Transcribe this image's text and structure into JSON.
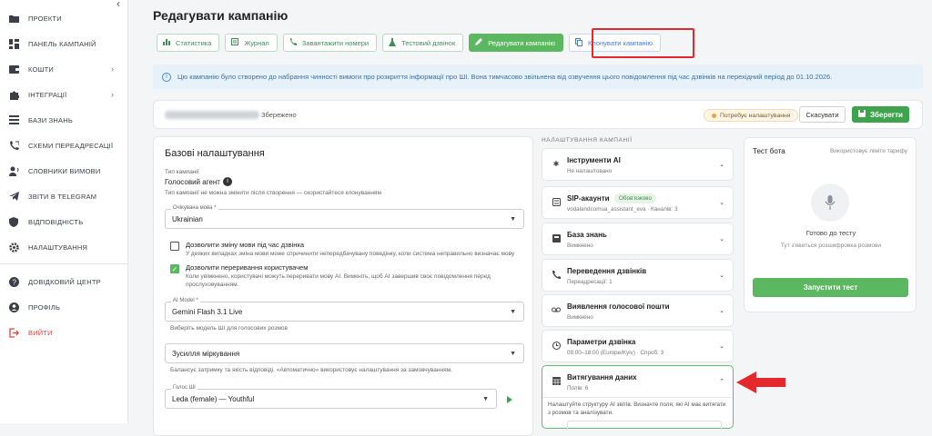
{
  "sidebar": {
    "items": [
      {
        "label": "Проекти",
        "icon": "folder-icon",
        "arrow": ""
      },
      {
        "label": "Панель кампаній",
        "icon": "dashboard-icon",
        "arrow": ""
      },
      {
        "label": "Кошти",
        "icon": "wallet-icon",
        "arrow": "›"
      },
      {
        "label": "Інтеграції",
        "icon": "puzzle-icon",
        "arrow": "›"
      },
      {
        "label": "Бази знань",
        "icon": "list-icon",
        "arrow": ""
      },
      {
        "label": "Схеми переадресації",
        "icon": "phone-forward-icon",
        "arrow": ""
      },
      {
        "label": "Словники вимови",
        "icon": "speaker-icon",
        "arrow": ""
      },
      {
        "label": "Звіти в Telegram",
        "icon": "telegram-icon",
        "arrow": ""
      },
      {
        "label": "Відповідність",
        "icon": "shield-icon",
        "arrow": ""
      },
      {
        "label": "Налаштування",
        "icon": "gear-icon",
        "arrow": ""
      },
      {
        "label": "Довідковий центр",
        "icon": "help-icon",
        "arrow": ""
      },
      {
        "label": "Профіль",
        "icon": "person-icon",
        "arrow": ""
      },
      {
        "label": "Вийти",
        "icon": "logout-icon",
        "arrow": ""
      }
    ]
  },
  "page": {
    "title": "Редагувати кампанію"
  },
  "tabs": [
    {
      "label": "Статистика",
      "icon": "chart-icon"
    },
    {
      "label": "Журнал",
      "icon": "journal-icon"
    },
    {
      "label": "Завантажити номери",
      "icon": "phone-icon"
    },
    {
      "label": "Тестовий дзвінок",
      "icon": "flask-icon"
    },
    {
      "label": "Редагувати кампанію",
      "icon": "pencil-icon"
    },
    {
      "label": "Клонувати кампанію",
      "icon": "copy-icon"
    }
  ],
  "notice": "Цю кампанію було створено до набрання чинності вимоги про розкриття інформації про ШІ. Вона тимчасово звільнена від озвучення цього повідомлення під час дзвінків на перехідний період до 01.10.2026.",
  "header_bar": {
    "saved": "Збережено",
    "status": "Потребує налаштування",
    "cancel": "Скасувати",
    "save": "Зберегти"
  },
  "basic": {
    "title": "Базові налаштування",
    "campaign_type_label": "Тип кампанії",
    "campaign_type_value": "Голосовий агент",
    "campaign_type_hint": "Тип кампанії не можна змінити після створення — скористайтеся клонуванням",
    "language_label": "Очікувана мова *",
    "language_value": "Ukrainian",
    "allow_lang_change": "Дозволити зміну мови під час дзвінка",
    "allow_lang_change_hint": "У деяких випадках зміна мови може спричинити непередбачувану поведінку, коли система неправильно визначає мову",
    "allow_interrupt": "Дозволити переривання користувачем",
    "allow_interrupt_hint_1": "Коли увімкнено, користувачі можуть переривати мову AI. Вимкніть, щоб AI завершив своє повідомлення перед",
    "allow_interrupt_hint_2": "прослуховуванням.",
    "model_label": "AI Model *",
    "model_value": "Gemini Flash 3.1 Live",
    "model_hint": "Виберіть модель ШІ для голосових розмов",
    "thinking_value": "Зусилля міркування",
    "thinking_hint": "Балансує затримку та якість відповіді. «Автоматично» використовує налаштування за замовчуванням.",
    "voice_label": "Голос ШІ",
    "voice_value": "Leda (female) — Youthful"
  },
  "settings": {
    "heading": "НАЛАШТУВАННЯ КАМПАНІЇ",
    "items": [
      {
        "title": "Інструменти AI",
        "desc": "Не налаштовано",
        "icon": "sparkle-icon",
        "badge": ""
      },
      {
        "title": "SIP-акаунти",
        "desc": "vodalandcomua_assistant_eva · Каналів: 3",
        "icon": "sip-icon",
        "badge": "Обов'язково"
      },
      {
        "title": "База знань",
        "desc": "Вимкнено",
        "icon": "book-icon",
        "badge": ""
      },
      {
        "title": "Переведення дзвінків",
        "desc": "Переадресації: 1",
        "icon": "phone-forward-icon",
        "badge": ""
      },
      {
        "title": "Виявлення голосової пошти",
        "desc": "Вимкнено",
        "icon": "voicemail-icon",
        "badge": ""
      },
      {
        "title": "Параметри дзвінка",
        "desc": "09:00–18:00 (Europe/Kyiv) · Спроб: 3",
        "icon": "clock-icon",
        "badge": ""
      },
      {
        "title": "Витягування даних",
        "desc": "Полів: 6",
        "icon": "table-icon",
        "badge": ""
      }
    ],
    "extract_text": "Налаштуйте структуру AI звітів. Визначте поля, які AI має витягати з розмов та аналізувати."
  },
  "test_bot": {
    "title": "Тест бота",
    "limits": "Використовує ліміти тарифу",
    "ready": "Готово до тесту",
    "transcript": "Тут з'явиться розшифровка розмови",
    "run": "Запустити тест"
  },
  "colors": {
    "accent": "#5cb860",
    "highlight": "#e5282b"
  }
}
